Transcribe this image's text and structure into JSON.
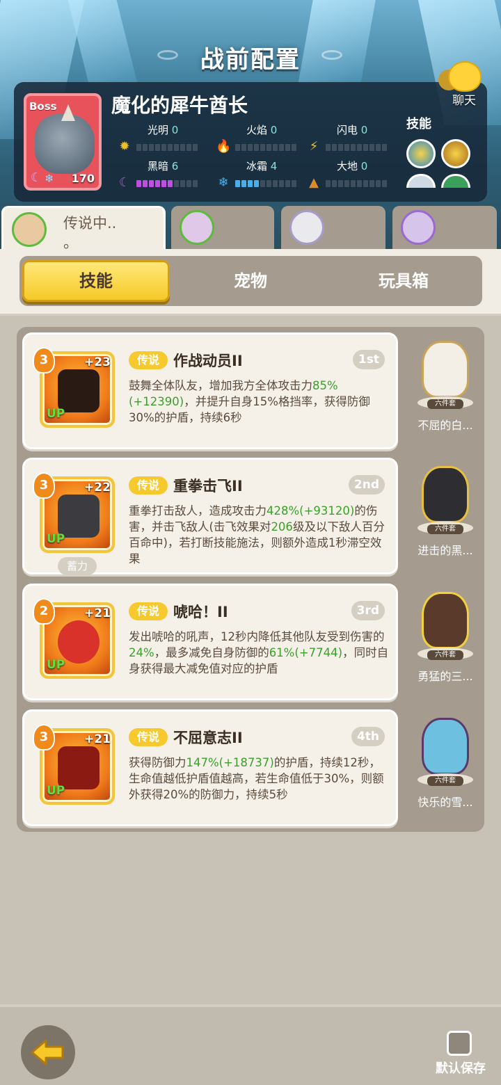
{
  "header": {
    "title": "战前配置",
    "chat_label": "聊天"
  },
  "boss": {
    "tag": "Boss",
    "name": "魔化的犀牛酋长",
    "level": "170",
    "elements": [
      {
        "id": "light",
        "label": "光明",
        "value": "0",
        "fill": 0,
        "color": "#f0c020",
        "icon": "sun-icon"
      },
      {
        "id": "fire",
        "label": "火焰",
        "value": "0",
        "fill": 0,
        "color": "#e8402a",
        "icon": "flame-icon"
      },
      {
        "id": "thunder",
        "label": "闪电",
        "value": "0",
        "fill": 0,
        "color": "#f0c020",
        "icon": "lightning-icon"
      },
      {
        "id": "dark",
        "label": "黑暗",
        "value": "6",
        "fill": 6,
        "color": "#c04ee0",
        "icon": "moon-icon"
      },
      {
        "id": "ice",
        "label": "冰霜",
        "value": "4",
        "fill": 4,
        "color": "#4aaee8",
        "icon": "snowflake-icon"
      },
      {
        "id": "earth",
        "label": "大地",
        "value": "0",
        "fill": 0,
        "color": "#e08a2a",
        "icon": "earth-icon"
      }
    ],
    "skills_label": "技能"
  },
  "team_tabs": [
    {
      "name": "传说中..\n。",
      "active": true
    },
    {
      "name": "",
      "active": false
    },
    {
      "name": "",
      "active": false
    },
    {
      "name": "",
      "active": false
    }
  ],
  "tabs": [
    {
      "label": "技能",
      "active": true
    },
    {
      "label": "宠物",
      "active": false
    },
    {
      "label": "玩具箱",
      "active": false
    }
  ],
  "skills": [
    {
      "level": "3",
      "plus": "+23",
      "up": "UP",
      "rarity": "传说",
      "name": "作战动员II",
      "rank": "1st",
      "desc": [
        "鼓舞全体队友，增加我方全体攻击力",
        {
          "g": "85%(+12390)"
        },
        "，并提升自身15%格挡率，获得防御30%的护盾，持续6秒"
      ],
      "pet": {
        "name": "不屈的白...",
        "set": "六件套"
      }
    },
    {
      "level": "3",
      "plus": "+22",
      "up": "UP",
      "rarity": "传说",
      "name": "重拳击飞II",
      "rank": "2nd",
      "charge": "蓄力",
      "desc": [
        "重拳打击敌人，造成攻击力",
        {
          "g": "428%(+93120)"
        },
        "的伤害，并击飞敌人(击飞效果对",
        {
          "g": "206"
        },
        "级及以下敌人百分百命中)，若打断技能施法，则额外造成1秒滞空效果"
      ],
      "pet": {
        "name": "进击的黑...",
        "set": "六件套"
      }
    },
    {
      "level": "2",
      "plus": "+21",
      "up": "UP",
      "rarity": "传说",
      "name": "唬哈！II",
      "rank": "3rd",
      "desc": [
        "发出唬哈的吼声，12秒内降低其他队友受到伤害的",
        {
          "g": "24%"
        },
        "，最多减免自身防御的",
        {
          "g": "61%(+7744)"
        },
        "，同时自身获得最大减免值对应的护盾"
      ],
      "pet": {
        "name": "勇猛的三...",
        "set": "六件套"
      }
    },
    {
      "level": "3",
      "plus": "+21",
      "up": "UP",
      "rarity": "传说",
      "name": "不屈意志II",
      "rank": "4th",
      "desc": [
        "获得防御力",
        {
          "g": "147%(+18737)"
        },
        "的护盾，持续12秒，生命值越低护盾值越高，若生命值低于30%，则额外获得20%的防御力，持续5秒"
      ],
      "pet": {
        "name": "快乐的雪...",
        "set": "六件套"
      }
    }
  ],
  "footer": {
    "save_label": "默认保存"
  }
}
